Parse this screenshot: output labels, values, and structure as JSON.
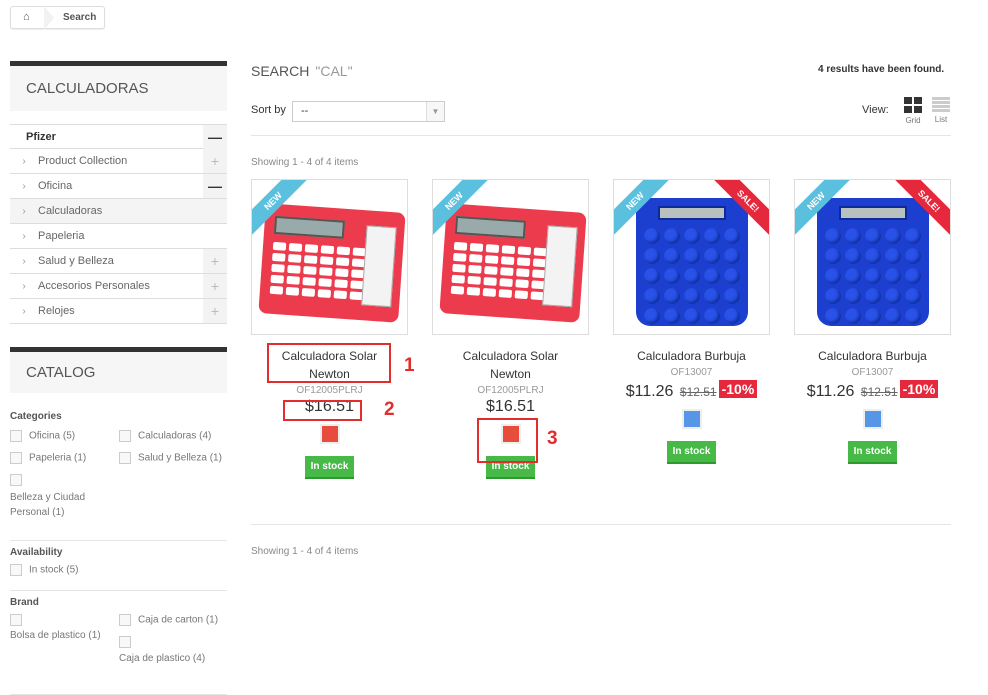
{
  "breadcrumb": {
    "home_icon": "home-icon",
    "current": "Search"
  },
  "sidebar": {
    "category_block": {
      "title": "CALCULADORAS",
      "items": [
        {
          "label": "Pfizer",
          "toggle": "minus"
        },
        {
          "label": "Product Collection",
          "toggle": "plus"
        },
        {
          "label": "Oficina",
          "toggle": "minus"
        },
        {
          "label": "Calculadoras",
          "toggle": "",
          "active": true
        },
        {
          "label": "Papeleria",
          "toggle": ""
        },
        {
          "label": "Salud y Belleza",
          "toggle": "plus"
        },
        {
          "label": "Accesorios Personales",
          "toggle": "plus"
        },
        {
          "label": "Relojes",
          "toggle": "plus"
        }
      ]
    },
    "catalog": {
      "title": "CATALOG",
      "categories": {
        "heading": "Categories",
        "options": [
          "Oficina (5)",
          "Calculadoras (4)",
          "Papeleria (1)",
          "Salud y Belleza (1)",
          "Belleza y Ciudad Personal (1)"
        ]
      },
      "availability": {
        "heading": "Availability",
        "options": [
          "In stock (5)"
        ]
      },
      "brand": {
        "heading": "Brand",
        "options": [
          "Bolsa de plastico (1)",
          "Caja de carton (1)",
          "Caja de plastico (4)"
        ]
      }
    }
  },
  "main": {
    "title": "SEARCH",
    "query": "\"CAL\"",
    "results": "4 results have been found.",
    "sort_label": "Sort by",
    "sort_value": "--",
    "view_label": "View:",
    "view_grid": "Grid",
    "view_list": "List",
    "showing_top": "Showing 1 - 4 of 4 items",
    "showing_bottom": "Showing 1 - 4 of 4 items",
    "products": [
      {
        "name": "Calculadora Solar Newton",
        "sku": "OF12005PLRJ",
        "price": "$16.51",
        "old_price": "",
        "discount": "",
        "badge": "NEW",
        "sale": "",
        "swatch": "#e84c3d",
        "stock": "In stock"
      },
      {
        "name": "Calculadora Solar Newton",
        "sku": "OF12005PLRJ",
        "price": "$16.51",
        "old_price": "",
        "discount": "",
        "badge": "NEW",
        "sale": "",
        "swatch": "#e84c3d",
        "stock": "In stock"
      },
      {
        "name": "Calculadora Burbuja",
        "sku": "OF13007",
        "price": "$11.26",
        "old_price": "$12.51",
        "discount": "-10%",
        "badge": "NEW",
        "sale": "SALE!",
        "swatch": "#5596e6",
        "stock": "In stock"
      },
      {
        "name": "Calculadora Burbuja",
        "sku": "OF13007",
        "price": "$11.26",
        "old_price": "$12.51",
        "discount": "-10%",
        "badge": "NEW",
        "sale": "SALE!",
        "swatch": "#5596e6",
        "stock": "In stock"
      }
    ]
  },
  "annotations": [
    "1",
    "2",
    "3"
  ],
  "colors": {
    "accent_red": "#e6283c",
    "stock_green": "#46b946",
    "new_blue": "#5bc0de",
    "annotation": "#e32c2c"
  }
}
